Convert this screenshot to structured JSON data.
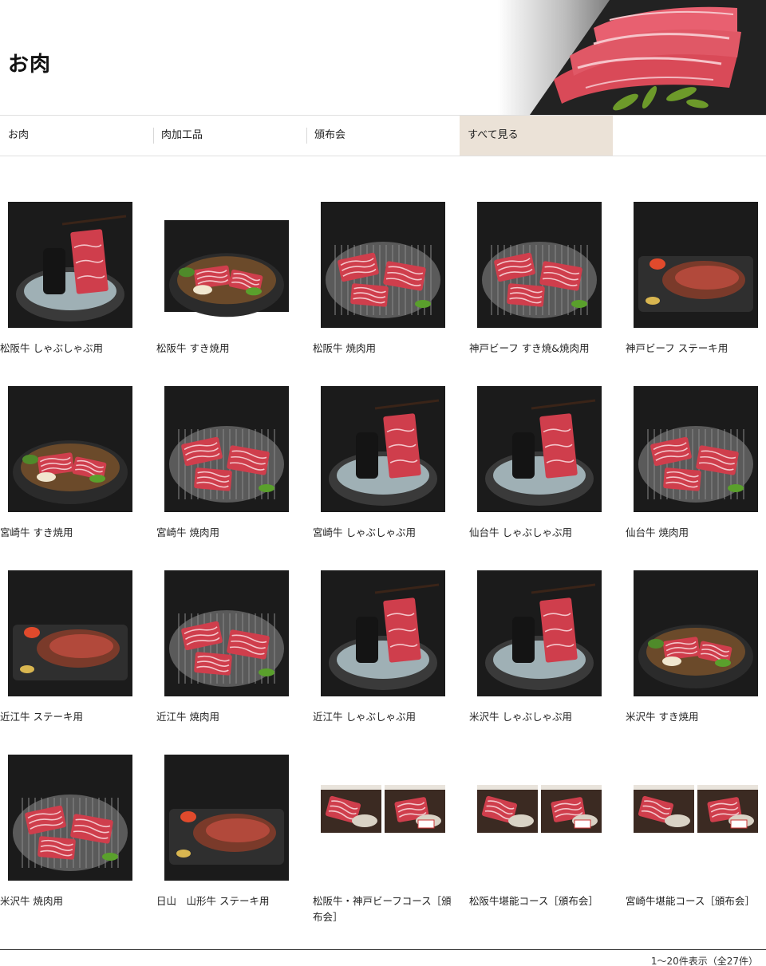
{
  "page": {
    "title": "お肉"
  },
  "categories": [
    {
      "label": "お肉",
      "active": false
    },
    {
      "label": "肉加工品",
      "active": false
    },
    {
      "label": "頒布会",
      "active": false
    },
    {
      "label": "すべて見る",
      "active": true
    }
  ],
  "products": [
    {
      "name": "松阪牛 しゃぶしゃぶ用",
      "dish": "shabu"
    },
    {
      "name": "松阪牛 すき焼用",
      "dish": "sukiyaki"
    },
    {
      "name": "松阪牛 焼肉用",
      "dish": "yakiniku"
    },
    {
      "name": "神戸ビーフ すき焼&焼肉用",
      "dish": "yakiniku"
    },
    {
      "name": "神戸ビーフ ステーキ用",
      "dish": "steak"
    },
    {
      "name": "宮崎牛 すき焼用",
      "dish": "sukiyaki"
    },
    {
      "name": "宮崎牛 焼肉用",
      "dish": "yakiniku"
    },
    {
      "name": "宮崎牛 しゃぶしゃぶ用",
      "dish": "shabu"
    },
    {
      "name": "仙台牛 しゃぶしゃぶ用",
      "dish": "shabu"
    },
    {
      "name": "仙台牛 焼肉用",
      "dish": "yakiniku"
    },
    {
      "name": "近江牛 ステーキ用",
      "dish": "steak"
    },
    {
      "name": "近江牛 焼肉用",
      "dish": "yakiniku"
    },
    {
      "name": "近江牛 しゃぶしゃぶ用",
      "dish": "shabu"
    },
    {
      "name": "米沢牛 しゃぶしゃぶ用",
      "dish": "shabu"
    },
    {
      "name": "米沢牛 すき焼用",
      "dish": "sukiyaki"
    },
    {
      "name": "米沢牛 焼肉用",
      "dish": "yakiniku"
    },
    {
      "name": "日山　山形牛 ステーキ用",
      "dish": "steak"
    },
    {
      "name": "松阪牛・神戸ビーフコース［頒布会］",
      "dish": "course"
    },
    {
      "name": "松阪牛堪能コース［頒布会］",
      "dish": "course"
    },
    {
      "name": "宮崎牛堪能コース［頒布会］",
      "dish": "course"
    }
  ],
  "pagination": {
    "summary": "1～20件表示（全27件）"
  },
  "colors": {
    "active_tab": "#ebe2d7",
    "meat_red": "#c8404a",
    "marbling": "#f3c9cc"
  }
}
